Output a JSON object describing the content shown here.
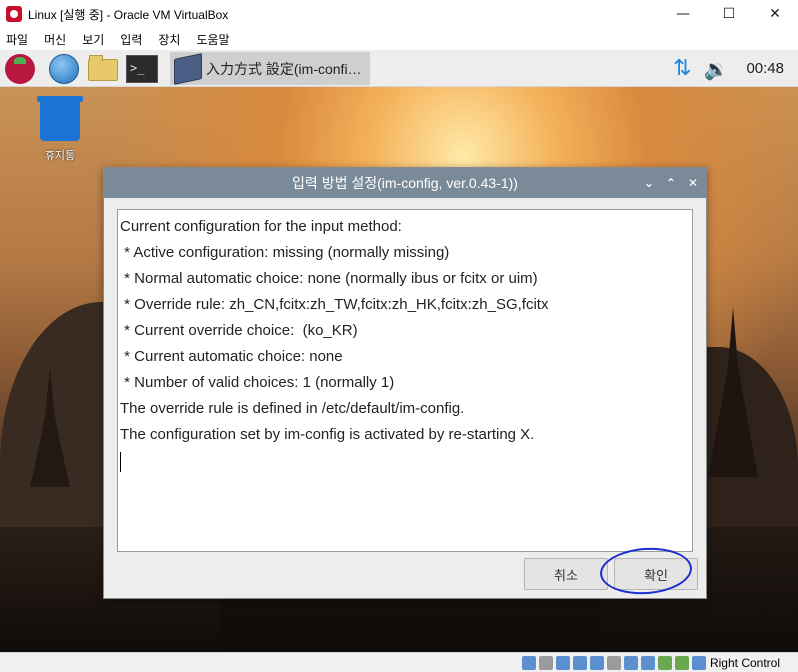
{
  "host_window": {
    "title": "Linux [실행 중] - Oracle VM VirtualBox",
    "controls": {
      "minimize": "—",
      "maximize": "☐",
      "close": "✕"
    }
  },
  "host_menu": [
    "파일",
    "머신",
    "보기",
    "입력",
    "장치",
    "도움말"
  ],
  "guest_panel": {
    "taskbar_item_label": "入力方式 設定(im-confi…",
    "clock": "00:48",
    "network_icon": "⇅",
    "volume_icon": "🔉"
  },
  "desktop": {
    "trash_label": "휴지통"
  },
  "dialog": {
    "title": "입력 방법 설정(im-config, ver.0.43-1))",
    "controls": {
      "minimize": "⌄",
      "maximize": "⌃",
      "close": "✕"
    },
    "lines": [
      "Current configuration for the input method:",
      " * Active configuration: missing (normally missing)",
      " * Normal automatic choice: none (normally ibus or fcitx or uim)",
      " * Override rule: zh_CN,fcitx:zh_TW,fcitx:zh_HK,fcitx:zh_SG,fcitx",
      " * Current override choice:  (ko_KR)",
      " * Current automatic choice: none",
      " * Number of valid choices: 1 (normally 1)",
      "The override rule is defined in /etc/default/im-config.",
      "The configuration set by im-config is activated by re-starting X."
    ],
    "buttons": {
      "cancel": "취소",
      "ok": "확인"
    }
  },
  "statusbar": {
    "host_key": "Right Control"
  }
}
